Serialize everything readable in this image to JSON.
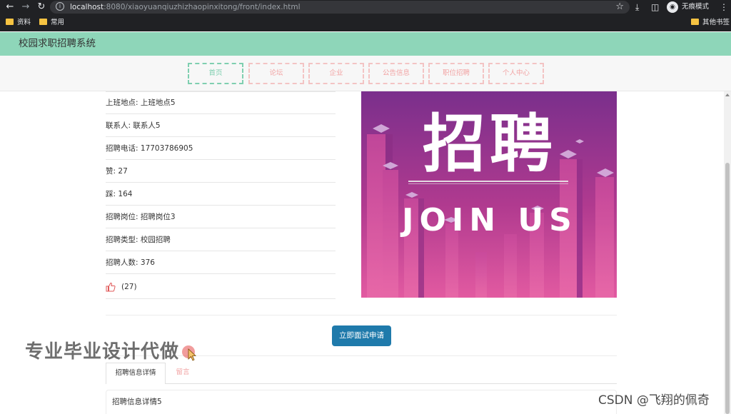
{
  "browser": {
    "url_host": "localhost",
    "url_rest": ":8080/xiaoyuanqiuzhizhaopinxitong/front/index.html",
    "profile_label": "无痕模式",
    "bookmarks": [
      "资料",
      "常用"
    ],
    "other_bookmarks": "其他书签",
    "icons": [
      "back-icon",
      "forward-icon",
      "reload-icon",
      "info-icon",
      "star-icon",
      "download-icon",
      "sidebar-icon",
      "incognito-icon",
      "menu-icon"
    ]
  },
  "header": {
    "title": "校园求职招聘系统",
    "bg_color": "#8ed6b9"
  },
  "nav": [
    {
      "label": "首页",
      "active": true
    },
    {
      "label": "论坛",
      "active": false
    },
    {
      "label": "企业",
      "active": false
    },
    {
      "label": "公告信息",
      "active": false
    },
    {
      "label": "职位招聘",
      "active": false
    },
    {
      "label": "个人中心",
      "active": false
    }
  ],
  "fields": [
    {
      "key": "上班地点",
      "value": "上班地点5"
    },
    {
      "key": "联系人",
      "value": "联系人5"
    },
    {
      "key": "招聘电话",
      "value": "17703786905"
    },
    {
      "key": "赞",
      "value": "27"
    },
    {
      "key": "踩",
      "value": "164"
    },
    {
      "key": "招聘岗位",
      "value": "招聘岗位3"
    },
    {
      "key": "招聘类型",
      "value": "校园招聘"
    },
    {
      "key": "招聘人数",
      "value": "376"
    }
  ],
  "likes": {
    "count": "(27)",
    "icon": "thumbs-up-icon"
  },
  "banner": {
    "title": "招聘",
    "subtitle": "JOIN US"
  },
  "apply_button": "立即面试申请",
  "tabs": [
    {
      "label": "招聘信息详情",
      "active": true
    },
    {
      "label": "留言",
      "active": false
    }
  ],
  "detail_text": "招聘信息详情5",
  "watermark": "专业毕业设计代做",
  "csdn_watermark": "CSDN @飞翔的佩奇",
  "colors": {
    "accent": "#1f7aab",
    "nav_inactive": "#f2a3a3",
    "nav_active": "#7fcfb0"
  }
}
